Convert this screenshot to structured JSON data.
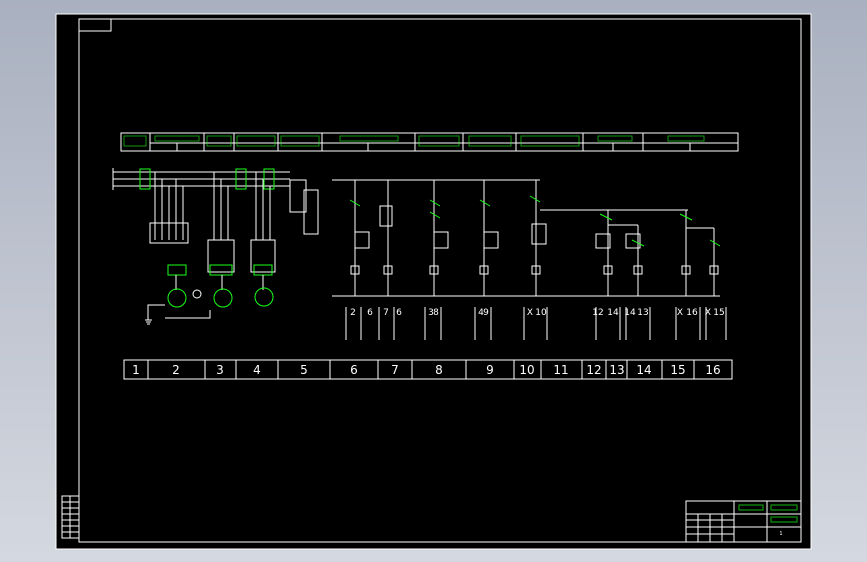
{
  "title_block": {
    "sheet": "1"
  },
  "column_numbers": [
    "1",
    "2",
    "3",
    "4",
    "5",
    "6",
    "7",
    "8",
    "9",
    "10",
    "11",
    "12",
    "13",
    "14",
    "15",
    "16"
  ],
  "cross_refs": [
    [
      "2",
      "6",
      "7"
    ],
    [
      "2",
      "7",
      "6"
    ],
    [
      "3",
      "8"
    ],
    [
      "4",
      "9"
    ],
    [
      "X",
      "10"
    ],
    [
      "12",
      "14"
    ],
    [
      "14",
      "13"
    ],
    [
      "X",
      "16"
    ],
    [
      "X",
      "15"
    ]
  ],
  "colors": {
    "background": "#000000",
    "frame": "#ffffff",
    "wiring": "#1aff1a",
    "desktop": "#a9b0bf"
  }
}
